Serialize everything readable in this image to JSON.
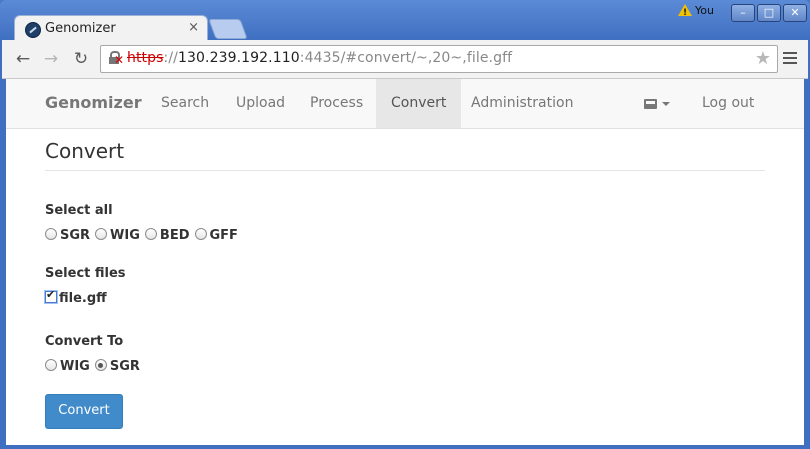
{
  "browser": {
    "tab_title": "Genomizer",
    "tab_close": "×",
    "user_name": "You",
    "url_scheme": "https",
    "url_sep": "://",
    "url_host": "130.239.192.110",
    "url_rest": ":4435/#convert/~,20~,file.gff",
    "window_buttons": [
      "–",
      "□",
      "✕"
    ]
  },
  "navbar": {
    "brand": "Genomizer",
    "items": [
      "Search",
      "Upload",
      "Process",
      "Convert",
      "Administration"
    ],
    "active": "Convert",
    "logout": "Log out"
  },
  "main": {
    "title": "Convert",
    "select_all": {
      "label": "Select all",
      "options": [
        "SGR",
        "WIG",
        "BED",
        "GFF"
      ]
    },
    "select_files": {
      "label": "Select files",
      "files": [
        {
          "name": "file.gff",
          "checked": true
        }
      ]
    },
    "convert_to": {
      "label": "Convert To",
      "options": [
        "WIG",
        "SGR"
      ],
      "selected": "SGR"
    },
    "convert_button": "Convert"
  },
  "colors": {
    "primary_button": "#428bca",
    "frame": "#3f6fc0"
  }
}
